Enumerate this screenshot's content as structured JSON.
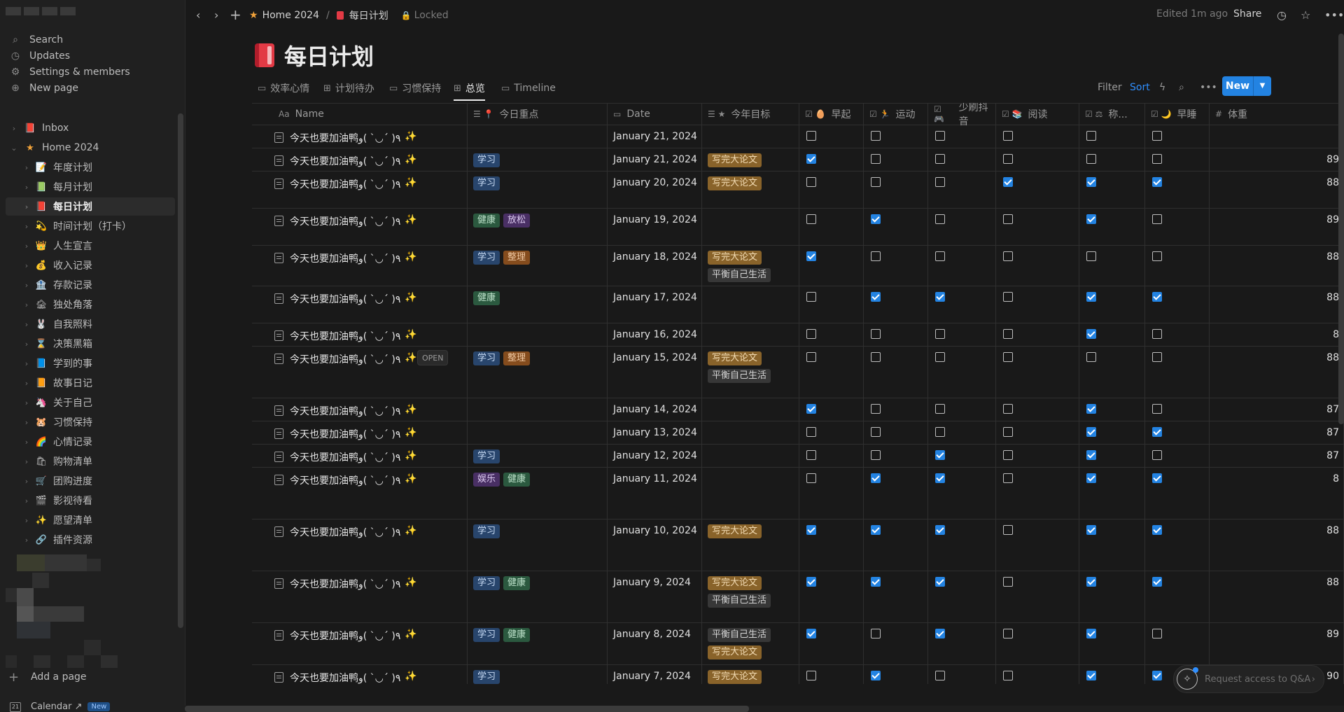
{
  "sidebar": {
    "nav": [
      {
        "label": "Search",
        "icon": "search-icon",
        "glyph": "⌕"
      },
      {
        "label": "Updates",
        "icon": "clock-icon",
        "glyph": "◷"
      },
      {
        "label": "Settings & members",
        "icon": "gear-icon",
        "glyph": "⚙"
      },
      {
        "label": "New page",
        "icon": "plus-circle-icon",
        "glyph": "⊕"
      }
    ],
    "tree": [
      {
        "label": "Inbox",
        "emoji": "📕",
        "chev": "›",
        "level": 0
      },
      {
        "label": "Home 2024",
        "emoji": "★",
        "chev": "⌄",
        "level": 0
      },
      {
        "label": "年度计划",
        "emoji": "📝",
        "chev": "›",
        "level": 1
      },
      {
        "label": "每月计划",
        "emoji": "📗",
        "chev": "›",
        "level": 1
      },
      {
        "label": "每日计划",
        "emoji": "📕",
        "chev": "›",
        "level": 1,
        "active": true
      },
      {
        "label": "时间计划（打卡）",
        "emoji": "💫",
        "chev": "›",
        "level": 1
      },
      {
        "label": "人生宣言",
        "emoji": "👑",
        "chev": "›",
        "level": 1
      },
      {
        "label": "收入记录",
        "emoji": "💰",
        "chev": "›",
        "level": 1
      },
      {
        "label": "存款记录",
        "emoji": "🏦",
        "chev": "›",
        "level": 1
      },
      {
        "label": "独处角落",
        "emoji": "🏚",
        "chev": "›",
        "level": 1
      },
      {
        "label": "自我照料",
        "emoji": "🐰",
        "chev": "›",
        "level": 1
      },
      {
        "label": "决策黑箱",
        "emoji": "⌛",
        "chev": "›",
        "level": 1
      },
      {
        "label": "学到的事",
        "emoji": "📘",
        "chev": "›",
        "level": 1
      },
      {
        "label": "故事日记",
        "emoji": "📙",
        "chev": "›",
        "level": 1
      },
      {
        "label": "关于自己",
        "emoji": "🦄",
        "chev": "›",
        "level": 1
      },
      {
        "label": "习惯保持",
        "emoji": "🐹",
        "chev": "›",
        "level": 1
      },
      {
        "label": "心情记录",
        "emoji": "🌈",
        "chev": "›",
        "level": 1
      },
      {
        "label": "购物清单",
        "emoji": "🛍",
        "chev": "›",
        "level": 1
      },
      {
        "label": "团购进度",
        "emoji": "🛒",
        "chev": "›",
        "level": 1
      },
      {
        "label": "影视待看",
        "emoji": "🎬",
        "chev": "›",
        "level": 1
      },
      {
        "label": "愿望清单",
        "emoji": "✨",
        "chev": "›",
        "level": 1
      },
      {
        "label": "插件资源",
        "emoji": "🔗",
        "chev": "›",
        "level": 1
      }
    ],
    "add_page": "Add a page",
    "calendar": {
      "label": "Calendar ↗",
      "badge": "New"
    }
  },
  "topbar": {
    "breadcrumb": [
      "Home 2024",
      "每日计划"
    ],
    "separator": "/",
    "locked": "Locked",
    "edited": "Edited 1m ago",
    "share": "Share"
  },
  "page": {
    "title": "每日计划"
  },
  "views": [
    {
      "label": "效率心情",
      "glyph": "▭"
    },
    {
      "label": "计划待办",
      "glyph": "⊞"
    },
    {
      "label": "习惯保持",
      "glyph": "▭"
    },
    {
      "label": "总览",
      "glyph": "⊞",
      "active": true
    },
    {
      "label": "Timeline",
      "glyph": "▭"
    }
  ],
  "toolbar": {
    "filter": "Filter",
    "sort": "Sort",
    "new": "New"
  },
  "columns": [
    {
      "label": "Name",
      "glyph": "Aa"
    },
    {
      "label": "今日重点",
      "glyph": "☰ 📍"
    },
    {
      "label": "Date",
      "glyph": "▭"
    },
    {
      "label": "今年目标",
      "glyph": "☰ ★"
    },
    {
      "label": "早起",
      "glyph": "☑ 🥚"
    },
    {
      "label": "运动",
      "glyph": "☑ 🏃"
    },
    {
      "label": "少刷抖音",
      "glyph": "☑ 🎮"
    },
    {
      "label": "阅读",
      "glyph": "☑ 📚"
    },
    {
      "label": "称...",
      "glyph": "☑ ⚖"
    },
    {
      "label": "早睡",
      "glyph": "☑ 🌙"
    },
    {
      "label": "体重",
      "glyph": "#"
    }
  ],
  "rows": [
    {
      "name": "今天也要加油鸭٩( ´◡` )و",
      "tags": [],
      "date": "January 21, 2024",
      "goals": [],
      "checks": [
        false,
        false,
        false,
        false,
        false,
        false
      ],
      "weight": ""
    },
    {
      "name": "今天也要加油鸭٩( ´◡` )و",
      "tags": [
        "学习"
      ],
      "date": "January 21, 2024",
      "goals": [
        "写完大论文"
      ],
      "checks": [
        true,
        false,
        false,
        false,
        false,
        false
      ],
      "weight": "89"
    },
    {
      "name": "今天也要加油鸭٩( ´◡` )و",
      "tags": [
        "学习"
      ],
      "date": "January 20, 2024",
      "goals": [
        "写完大论文"
      ],
      "checks": [
        false,
        false,
        false,
        true,
        true,
        true
      ],
      "weight": "88"
    },
    {
      "name": "今天也要加油鸭٩( ´◡` )و",
      "tags": [
        "健康",
        "放松"
      ],
      "date": "January 19, 2024",
      "goals": [],
      "checks": [
        false,
        true,
        false,
        false,
        true,
        false
      ],
      "weight": "89"
    },
    {
      "name": "今天也要加油鸭٩( ´◡` )و",
      "tags": [
        "学习",
        "整理"
      ],
      "date": "January 18, 2024",
      "goals": [
        "写完大论文",
        "平衡自己生活"
      ],
      "checks": [
        true,
        false,
        false,
        false,
        false,
        false
      ],
      "weight": "88"
    },
    {
      "name": "今天也要加油鸭٩( ´◡` )و",
      "tags": [
        "健康"
      ],
      "date": "January 17, 2024",
      "goals": [],
      "checks": [
        false,
        true,
        true,
        false,
        true,
        true
      ],
      "weight": "88"
    },
    {
      "name": "今天也要加油鸭٩( ´◡` )و",
      "tags": [],
      "date": "January 16, 2024",
      "goals": [],
      "checks": [
        false,
        false,
        false,
        false,
        true,
        false
      ],
      "weight": "8"
    },
    {
      "name": "今天也要加油鸭٩( ´◡` )و",
      "tags": [
        "学习",
        "整理"
      ],
      "date": "January 15, 2024",
      "goals": [
        "写完大论文",
        "平衡自己生活"
      ],
      "checks": [
        false,
        false,
        false,
        false,
        false,
        false
      ],
      "weight": "88",
      "open": "OPEN"
    },
    {
      "name": "今天也要加油鸭٩( ´◡` )و",
      "tags": [],
      "date": "January 14, 2024",
      "goals": [],
      "checks": [
        true,
        false,
        false,
        false,
        true,
        false
      ],
      "weight": "87"
    },
    {
      "name": "今天也要加油鸭٩( ´◡` )و",
      "tags": [],
      "date": "January 13, 2024",
      "goals": [],
      "checks": [
        false,
        false,
        false,
        false,
        true,
        true
      ],
      "weight": "87"
    },
    {
      "name": "今天也要加油鸭٩( ´◡` )و",
      "tags": [
        "学习"
      ],
      "date": "January 12, 2024",
      "goals": [],
      "checks": [
        false,
        false,
        true,
        false,
        true,
        false
      ],
      "weight": "87"
    },
    {
      "name": "今天也要加油鸭٩( ´◡` )و",
      "tags": [
        "娱乐",
        "健康"
      ],
      "date": "January 11, 2024",
      "goals": [],
      "checks": [
        false,
        true,
        true,
        false,
        true,
        true
      ],
      "weight": "8"
    },
    {
      "name": "今天也要加油鸭٩( ´◡` )و",
      "tags": [
        "学习"
      ],
      "date": "January 10, 2024",
      "goals": [
        "写完大论文"
      ],
      "checks": [
        true,
        true,
        true,
        false,
        true,
        true
      ],
      "weight": "88"
    },
    {
      "name": "今天也要加油鸭٩( ´◡` )و",
      "tags": [
        "学习",
        "健康"
      ],
      "date": "January 9, 2024",
      "goals": [
        "写完大论文",
        "平衡自己生活"
      ],
      "checks": [
        true,
        true,
        true,
        false,
        true,
        true
      ],
      "weight": "88"
    },
    {
      "name": "今天也要加油鸭٩( ´◡` )و",
      "tags": [
        "学习",
        "健康"
      ],
      "date": "January 8, 2024",
      "goals": [
        "平衡自己生活",
        "写完大论文"
      ],
      "checks": [
        true,
        false,
        true,
        false,
        true,
        false
      ],
      "weight": "89"
    },
    {
      "name": "今天也要加油鸭٩( ´◡` )و",
      "tags": [
        "学习"
      ],
      "date": "January 7, 2024",
      "goals": [
        "写完大论文"
      ],
      "checks": [
        false,
        true,
        false,
        false,
        true,
        true
      ],
      "weight": "90"
    }
  ],
  "qa": {
    "label": "Request access to Q&A"
  },
  "colors": {
    "accent": "#2383e2",
    "background": "#191919",
    "sidebar": "#202020"
  }
}
